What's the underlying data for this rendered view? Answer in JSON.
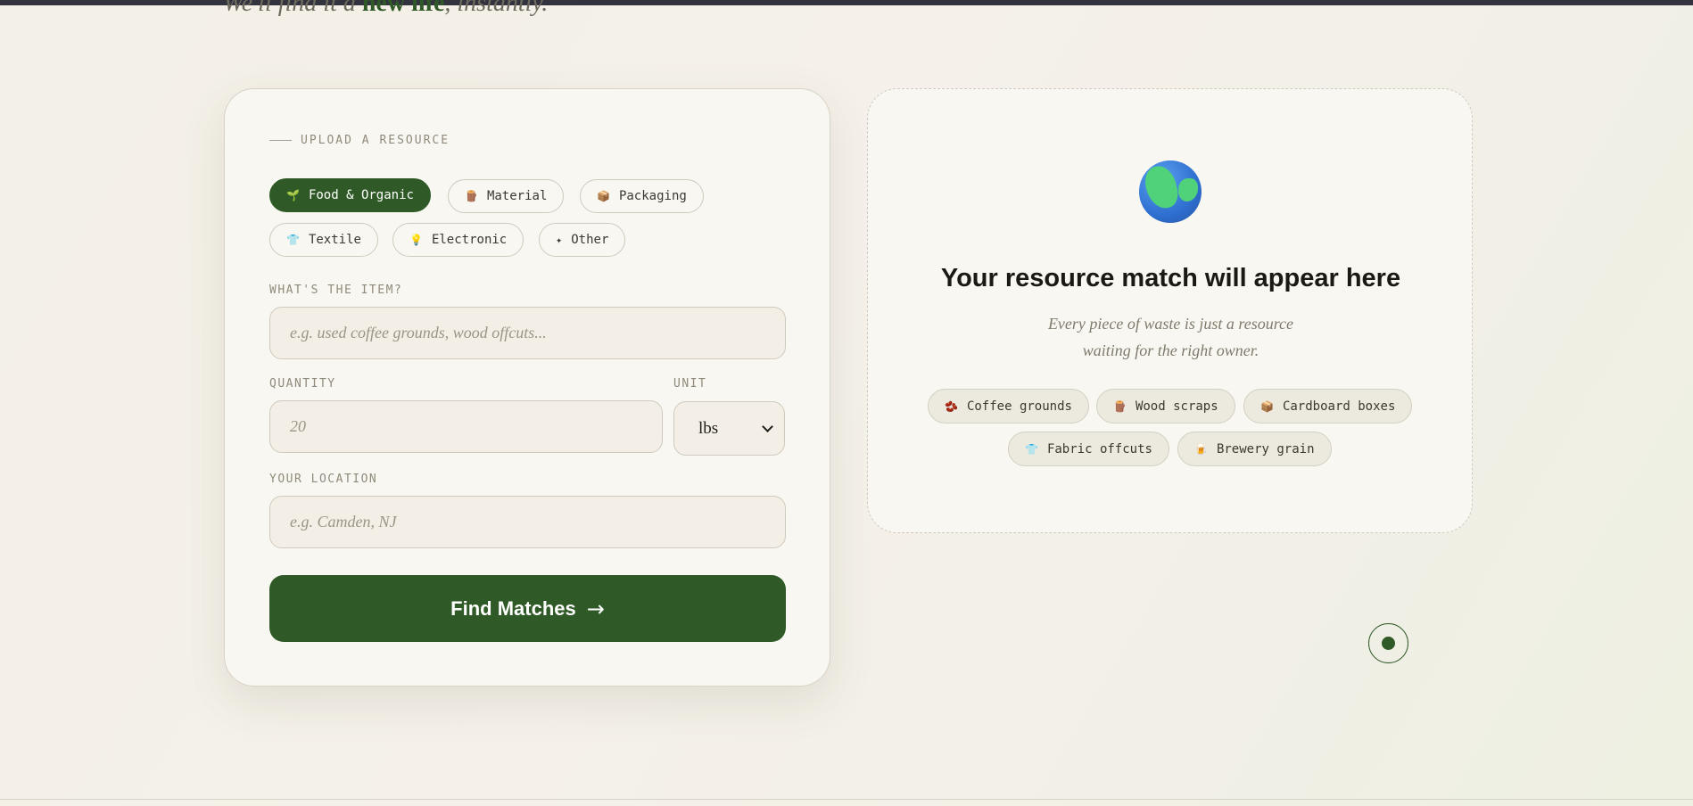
{
  "tagline": {
    "prefix": "We'll find it a ",
    "highlight": "new life",
    "suffix": ", instantly."
  },
  "form": {
    "section_label": "UPLOAD A RESOURCE",
    "categories": [
      {
        "icon": "🌱",
        "label": "Food & Organic",
        "active": true
      },
      {
        "icon": "🪵",
        "label": "Material",
        "active": false
      },
      {
        "icon": "📦",
        "label": "Packaging",
        "active": false
      },
      {
        "icon": "👕",
        "label": "Textile",
        "active": false
      },
      {
        "icon": "💡",
        "label": "Electronic",
        "active": false
      },
      {
        "icon": "✦",
        "label": "Other",
        "active": false
      }
    ],
    "item_label": "WHAT'S THE ITEM?",
    "item_placeholder": "e.g. used coffee grounds, wood offcuts...",
    "quantity_label": "QUANTITY",
    "quantity_placeholder": "20",
    "unit_label": "UNIT",
    "unit_value": "lbs",
    "location_label": "YOUR LOCATION",
    "location_placeholder": "e.g. Camden, NJ",
    "submit_label": "Find Matches",
    "submit_arrow": "→"
  },
  "result": {
    "icon": "globe-icon",
    "title": "Your resource match will appear here",
    "subtitle_line1": "Every piece of waste is just a resource",
    "subtitle_line2": "waiting for the right owner.",
    "examples": [
      {
        "icon": "🫘",
        "label": "Coffee grounds"
      },
      {
        "icon": "🪵",
        "label": "Wood scraps"
      },
      {
        "icon": "📦",
        "label": "Cardboard boxes"
      },
      {
        "icon": "👕",
        "label": "Fabric offcuts"
      },
      {
        "icon": "🍺",
        "label": "Brewery grain"
      }
    ]
  },
  "colors": {
    "accent": "#2f5a27",
    "card_bg": "#f9f7f1",
    "page_bg": "#f3f0e7"
  }
}
